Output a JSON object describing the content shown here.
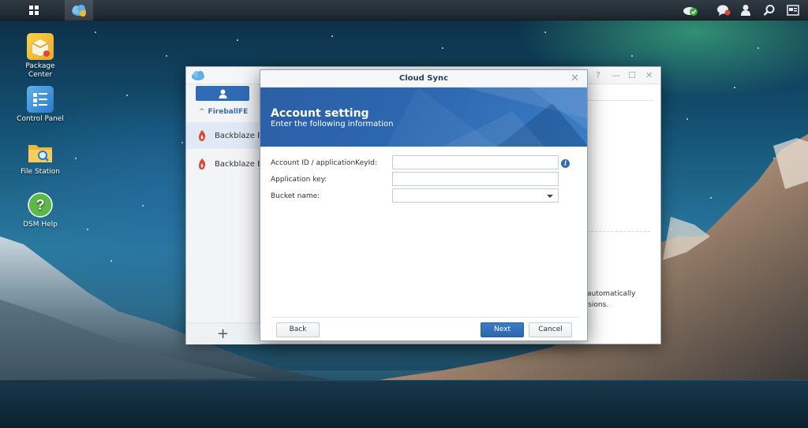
{
  "desktop": {
    "icons": [
      {
        "label": "Package\nCenter"
      },
      {
        "label": "Control Panel"
      },
      {
        "label": "File Station"
      },
      {
        "label": "DSM Help"
      }
    ]
  },
  "main_window": {
    "group": "FireballFE",
    "items": [
      {
        "label": "Backblaze B"
      },
      {
        "label": "Backblaze B"
      }
    ],
    "add_button": "+",
    "window_controls": [
      "?",
      "—",
      "☐",
      "✕"
    ],
    "right_text_line1": "automatically",
    "right_text_line2": "ersions."
  },
  "dialog": {
    "title": "Cloud Sync",
    "heading": "Account setting",
    "subheading": "Enter the following information",
    "fields": {
      "account_id_label": "Account ID / applicationKeyId:",
      "account_id_value": "",
      "app_key_label": "Application key:",
      "app_key_value": "",
      "bucket_label": "Bucket name:",
      "bucket_value": ""
    },
    "buttons": {
      "back": "Back",
      "next": "Next",
      "cancel": "Cancel"
    },
    "close": "✕"
  },
  "colors": {
    "accent": "#2f6cb5",
    "banner": "#2c5fa6",
    "taskbar": "#232c34"
  }
}
